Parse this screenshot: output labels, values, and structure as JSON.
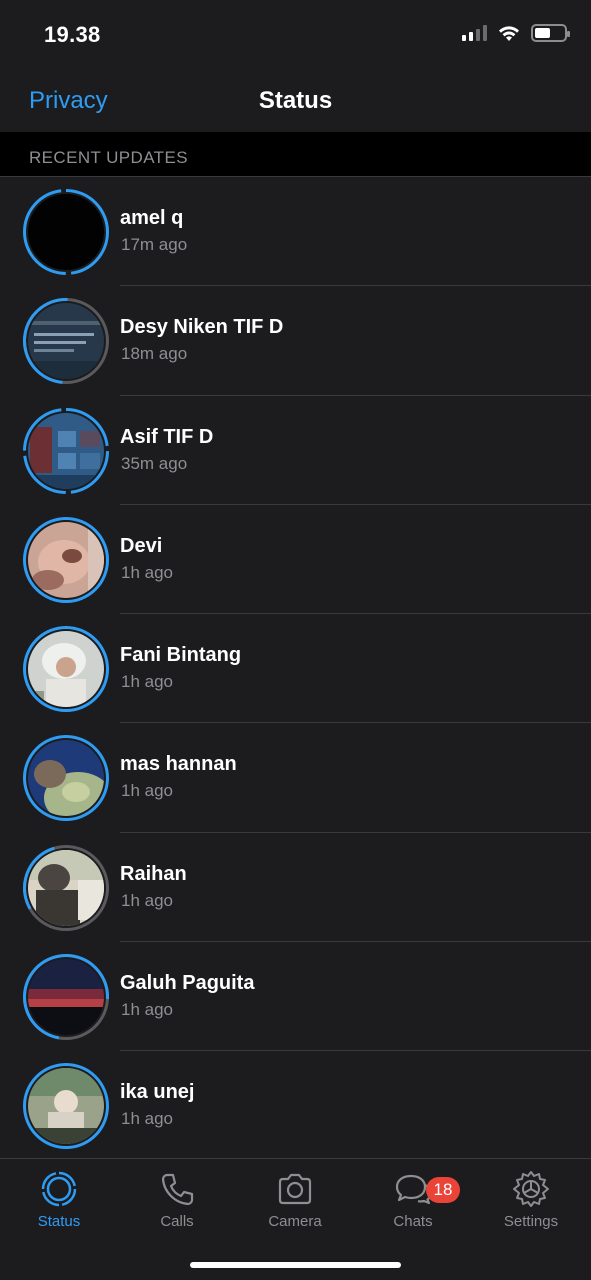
{
  "system": {
    "time": "19.38"
  },
  "nav": {
    "left": "Privacy",
    "title": "Status"
  },
  "section": {
    "title": "RECENT UPDATES"
  },
  "statuses": [
    {
      "name": "amel q",
      "ago": "17m ago"
    },
    {
      "name": "Desy Niken TIF D",
      "ago": "18m ago"
    },
    {
      "name": "Asif TIF D",
      "ago": "35m ago"
    },
    {
      "name": "Devi",
      "ago": "1h ago"
    },
    {
      "name": "Fani Bintang",
      "ago": "1h ago"
    },
    {
      "name": "mas hannan",
      "ago": "1h ago"
    },
    {
      "name": "Raihan",
      "ago": "1h ago"
    },
    {
      "name": "Galuh Paguita",
      "ago": "1h ago"
    },
    {
      "name": "ika unej",
      "ago": "1h ago"
    }
  ],
  "tabs": {
    "status": "Status",
    "calls": "Calls",
    "camera": "Camera",
    "chats": "Chats",
    "chats_badge": "18",
    "settings": "Settings"
  },
  "colors": {
    "accent": "#2f9cf4",
    "badge": "#ea4338",
    "unseen_ring": "#2f9cf4",
    "seen_ring": "#5a5a5e"
  }
}
